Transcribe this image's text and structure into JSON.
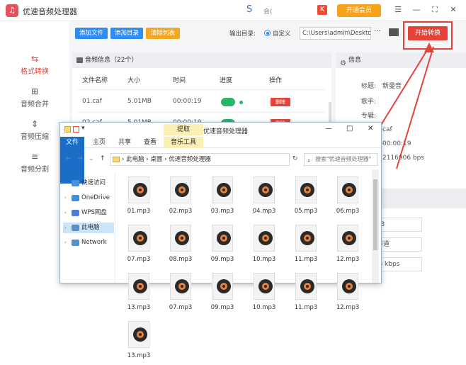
{
  "app": {
    "title": "优速音频处理器",
    "logo_glyph": "♫",
    "user": "会(",
    "vip_label": "开通会员",
    "window_controls": [
      "☰",
      "—",
      "⛶",
      "✕"
    ]
  },
  "sidebar": {
    "items": [
      {
        "label": "格式转换",
        "icon": "⇆",
        "active": true
      },
      {
        "label": "音频合并",
        "icon": "⊞",
        "active": false
      },
      {
        "label": "音频压缩",
        "icon": "⇕",
        "active": false
      },
      {
        "label": "音频分割",
        "icon": "≡",
        "active": false
      }
    ]
  },
  "toolbar": {
    "add_file": "添加文件",
    "add_dir": "添加目录",
    "clear_list": "清除列表",
    "output_label": "输出目录:",
    "custom_label": "自定义",
    "path": "C:\\Users\\admin\\Deskto",
    "more": "···",
    "start": "开始转换"
  },
  "audio_panel": {
    "header": "音频信息（22个）",
    "columns": [
      "文件名称",
      "大小",
      "时间",
      "进度",
      "操作"
    ],
    "rows": [
      {
        "name": "01.caf",
        "size": "5.01MB",
        "time": "00:00:19",
        "action": "删除"
      },
      {
        "name": "02.caf",
        "size": "5.01MB",
        "time": "00:00:19",
        "action": "删除"
      }
    ]
  },
  "info_panel": {
    "header": "信息",
    "title_label": "标题:",
    "title_value": "新曼音",
    "singer_label": "歌手:",
    "album_label": "专辑:",
    "format_value": "caf",
    "duration_value": "00:00:19",
    "bitrate_value": "2116906 bps",
    "settings": {
      "format": "mp3",
      "channel": "单声道",
      "bitrate": "128 kbps"
    }
  },
  "explorer": {
    "extract_label": "提取",
    "title": "优速音频处理器",
    "tabs": [
      "文件",
      "主页",
      "共享",
      "查看",
      "音乐工具"
    ],
    "nav_back": "←",
    "nav_fwd": "→",
    "nav_recent": "⌄",
    "nav_up": "↑",
    "address": "›  此电脑  ›  桌面  ›  优速音频处理器",
    "search_placeholder": "搜索\"优速音频处理器\"",
    "nav_items": [
      {
        "label": "快速访问",
        "color": "#4a90d9"
      },
      {
        "label": "OneDrive",
        "color": "#3b8ee0"
      },
      {
        "label": "WPS网盘",
        "color": "#4a7fd6"
      },
      {
        "label": "此电脑",
        "color": "#5a8fc9"
      },
      {
        "label": "Network",
        "color": "#5a8fc9"
      }
    ],
    "files": [
      "01.mp3",
      "02.mp3",
      "03.mp3",
      "04.mp3",
      "05.mp3",
      "06.mp3",
      "07.mp3",
      "08.mp3",
      "09.mp3",
      "10.mp3",
      "11.mp3",
      "12.mp3",
      "13.mp3",
      "07.mp3",
      "09.mp3",
      "10.mp3",
      "11.mp3",
      "12.mp3",
      "13.mp3"
    ]
  }
}
